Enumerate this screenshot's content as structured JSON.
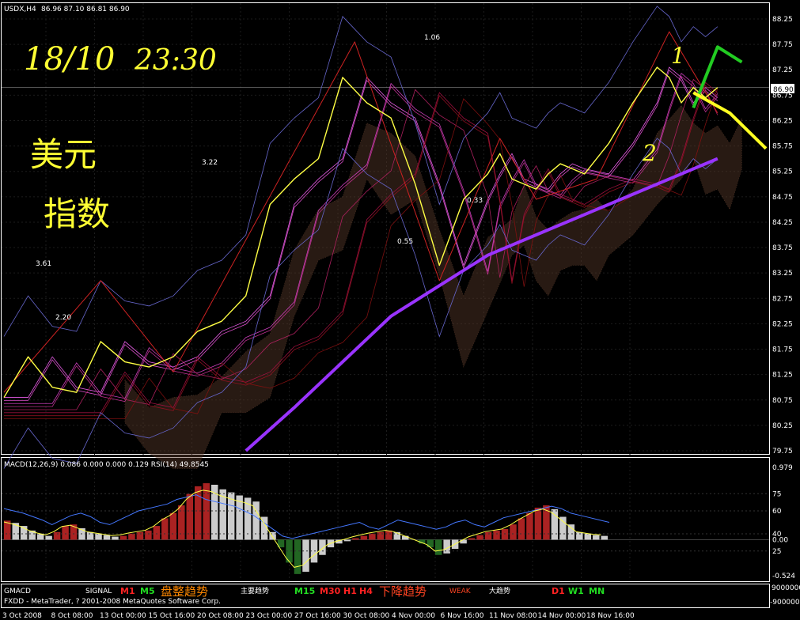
{
  "header": {
    "symbol": "USDX,H4",
    "ohlc": "86.96 87.10 86.81 86.90"
  },
  "annotations": {
    "date_handwritten": "18/10",
    "time_handwritten": "23:30",
    "chinese_line1": "美元",
    "chinese_line2": "指数",
    "wave_label_1": "1",
    "wave_label_2": "2"
  },
  "chart_data": [
    {
      "type": "line",
      "title": "USDX,H4",
      "ylim": [
        79.75,
        88.25
      ],
      "price_ticks": [
        "88.25",
        "87.75",
        "87.25",
        "86.75",
        "86.25",
        "85.75",
        "85.25",
        "84.75",
        "84.25",
        "83.75",
        "83.25",
        "82.75",
        "82.25",
        "81.75",
        "81.25",
        "80.75",
        "80.25",
        "79.75"
      ],
      "last_price": "86.90",
      "x_tick_labels": [
        "3 Oct 2008",
        "8 Oct 08:00",
        "13 Oct 00:00",
        "15 Oct 16:00",
        "20 Oct 08:00",
        "23 Oct 00:00",
        "27 Oct 16:00",
        "30 Oct 08:00",
        "4 Nov 00:00",
        "6 Nov 16:00",
        "11 Nov 08:00",
        "14 Nov 00:00",
        "18 Nov 16:00"
      ],
      "fib_labels": [
        "1.06",
        "3.22",
        "3.61",
        "2.20",
        "0.33",
        "0.55"
      ],
      "series": [
        {
          "name": "zigzag",
          "color": "#cc2222",
          "points": [
            [
              0,
              80.9
            ],
            [
              8,
              83.1
            ],
            [
              14,
              81.3
            ],
            [
              29,
              87.8
            ],
            [
              36,
              83.1
            ],
            [
              41,
              85.9
            ],
            [
              44,
              84.7
            ],
            [
              49,
              85.1
            ],
            [
              55,
              88.0
            ],
            [
              59,
              86.4
            ]
          ]
        },
        {
          "name": "price",
          "color": "#ffff44",
          "points": [
            [
              0,
              80.8
            ],
            [
              2,
              81.6
            ],
            [
              4,
              81.0
            ],
            [
              6,
              80.9
            ],
            [
              8,
              81.9
            ],
            [
              10,
              81.5
            ],
            [
              12,
              81.4
            ],
            [
              14,
              81.6
            ],
            [
              16,
              82.1
            ],
            [
              18,
              82.3
            ],
            [
              20,
              82.8
            ],
            [
              22,
              84.6
            ],
            [
              24,
              85.1
            ],
            [
              26,
              85.5
            ],
            [
              28,
              87.1
            ],
            [
              30,
              86.6
            ],
            [
              32,
              86.3
            ],
            [
              34,
              85.0
            ],
            [
              36,
              83.4
            ],
            [
              38,
              84.7
            ],
            [
              40,
              85.2
            ],
            [
              41,
              85.6
            ],
            [
              42,
              85.1
            ],
            [
              43,
              85.0
            ],
            [
              44,
              84.9
            ],
            [
              45,
              85.2
            ],
            [
              46,
              85.4
            ],
            [
              47,
              85.3
            ],
            [
              48,
              85.2
            ],
            [
              50,
              85.8
            ],
            [
              52,
              86.6
            ],
            [
              54,
              87.3
            ],
            [
              55,
              87.1
            ],
            [
              56,
              86.6
            ],
            [
              57,
              86.9
            ],
            [
              58,
              86.7
            ],
            [
              59,
              86.9
            ]
          ]
        },
        {
          "name": "long_ma",
          "color": "#9933ff",
          "points": [
            [
              20,
              79.75
            ],
            [
              24,
              80.6
            ],
            [
              28,
              81.5
            ],
            [
              32,
              82.4
            ],
            [
              36,
              83.0
            ],
            [
              40,
              83.6
            ],
            [
              44,
              84.0
            ],
            [
              48,
              84.4
            ],
            [
              52,
              84.8
            ],
            [
              56,
              85.2
            ],
            [
              59,
              85.5
            ]
          ]
        },
        {
          "name": "forecast_green",
          "color": "#22cc22",
          "points": [
            [
              57,
              86.5
            ],
            [
              59,
              87.7
            ],
            [
              61,
              87.4
            ]
          ]
        },
        {
          "name": "forecast_yellow",
          "color": "#ffff22",
          "points": [
            [
              57,
              86.8
            ],
            [
              60,
              86.4
            ],
            [
              63,
              85.7
            ]
          ]
        }
      ]
    },
    {
      "type": "bar",
      "title": "MACD(12,26,9) 0.086 0.000 0.000 0.129 RSI(14) 49.8545",
      "ylim": [
        -0.524,
        0.979
      ],
      "y_tick_labels": [
        "0.979",
        "75",
        "60",
        "40",
        "0.00",
        "25",
        "-0.524"
      ],
      "rsi_levels": [
        75,
        60,
        40,
        25
      ],
      "macd_values": [
        0.25,
        0.22,
        0.18,
        0.12,
        0.08,
        0.05,
        0.1,
        0.18,
        0.2,
        0.15,
        0.1,
        0.08,
        0.06,
        0.04,
        0.05,
        0.08,
        0.1,
        0.12,
        0.18,
        0.28,
        0.35,
        0.45,
        0.6,
        0.7,
        0.74,
        0.72,
        0.66,
        0.62,
        0.58,
        0.55,
        0.5,
        0.3,
        0.1,
        -0.1,
        -0.3,
        -0.45,
        -0.42,
        -0.3,
        -0.2,
        -0.1,
        -0.05,
        -0.02,
        0.02,
        0.05,
        0.08,
        0.1,
        0.12,
        0.1,
        0.05,
        0.0,
        -0.05,
        -0.1,
        -0.2,
        -0.18,
        -0.12,
        -0.05,
        0.02,
        0.06,
        0.1,
        0.12,
        0.14,
        0.2,
        0.28,
        0.35,
        0.42,
        0.45,
        0.4,
        0.3,
        0.2,
        0.1,
        0.08,
        0.06,
        0.05
      ],
      "rsi_values": [
        62,
        60,
        58,
        55,
        52,
        48,
        52,
        56,
        58,
        55,
        50,
        48,
        52,
        56,
        60,
        62,
        64,
        66,
        70,
        72,
        74,
        70,
        68,
        66,
        64,
        60,
        56,
        50,
        44,
        38,
        36,
        38,
        40,
        42,
        44,
        46,
        48,
        50,
        46,
        44,
        48,
        52,
        50,
        48,
        46,
        44,
        46,
        50,
        52,
        48,
        46,
        50,
        54,
        56,
        58,
        60,
        62,
        64,
        62,
        58,
        56,
        54,
        52,
        50
      ]
    }
  ],
  "status_bar": {
    "indicator_name": "GMACD",
    "copyright": "FXDD - MetaTrader, ? 2001-2008 MetaQuotes Software Corp.",
    "signal": "SIGNAL",
    "m1": "M1",
    "m5": "M5",
    "range_trend": "盘整趋势",
    "main_trend": "主要趋势",
    "m15": "M15",
    "m30": "M30",
    "h1": "H1",
    "h4": "H4",
    "down_trend": "下降趋势",
    "weak": "WEAK",
    "big_trend": "大趋势",
    "d1": "D1",
    "w1": "W1",
    "mn": "MN",
    "right_top": "9000000",
    "right_bottom": "-9000000"
  },
  "colors": {
    "background": "#000000",
    "axis": "#ffffff",
    "grid": "#2a2a2a",
    "red_signal": "#ff2222",
    "green_signal": "#22dd22",
    "orange_signal": "#ff8800"
  }
}
